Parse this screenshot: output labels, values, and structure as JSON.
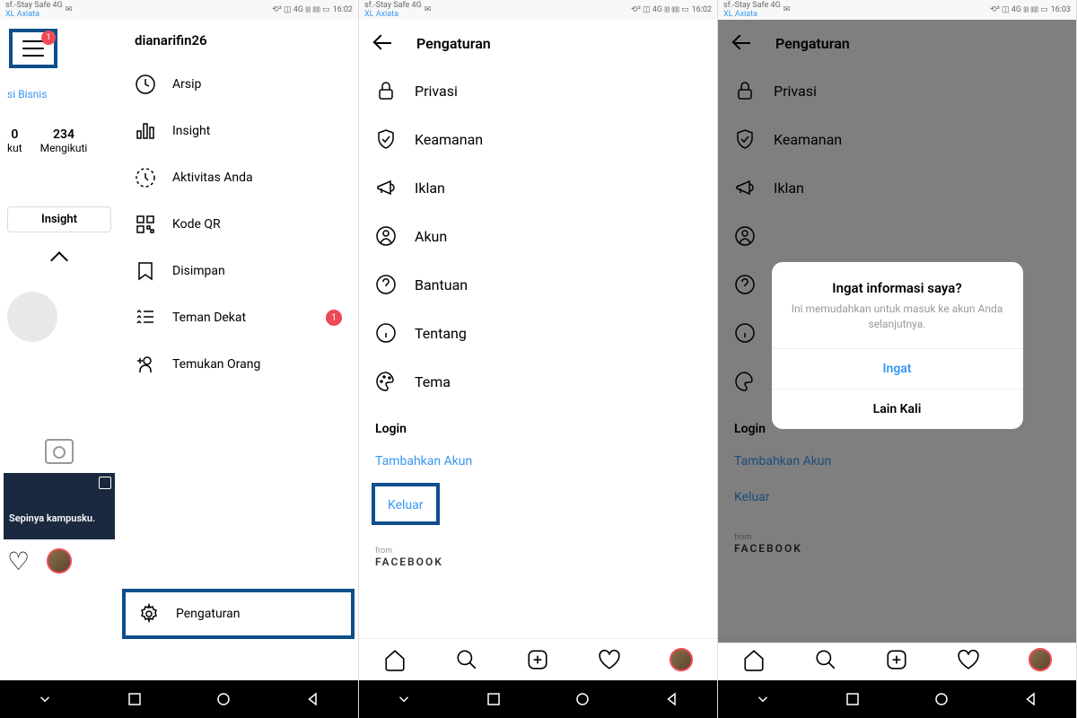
{
  "status": {
    "carrier_top": "sf.-Stay Safe 4G",
    "carrier_bottom": "XL Axiata",
    "time_1": "16:02",
    "time_2": "16:02",
    "time_3": "16:03",
    "net": "4G"
  },
  "phone1": {
    "notification_count": "1",
    "biz_link": "si Bisnis",
    "stat1_num": "0",
    "stat1_label": "kut",
    "stat2_num": "234",
    "stat2_label": "Mengikuti",
    "insight_btn": "Insight",
    "story_text": "Sepinya kampusku.",
    "username": "dianarifin26",
    "menu": {
      "arsip": "Arsip",
      "insight": "Insight",
      "aktivitas": "Aktivitas Anda",
      "kode_qr": "Kode QR",
      "disimpan": "Disimpan",
      "teman": "Teman Dekat",
      "teman_badge": "1",
      "temukan": "Temukan Orang"
    },
    "settings": "Pengaturan"
  },
  "phone2": {
    "title": "Pengaturan",
    "items": {
      "privasi": "Privasi",
      "keamanan": "Keamanan",
      "iklan": "Iklan",
      "akun": "Akun",
      "bantuan": "Bantuan",
      "tentang": "Tentang",
      "tema": "Tema"
    },
    "login_section": "Login",
    "tambah_akun": "Tambahkan Akun",
    "keluar": "Keluar",
    "from": "from",
    "facebook": "FACEBOOK"
  },
  "phone3": {
    "title": "Pengaturan",
    "items": {
      "privasi": "Privasi",
      "keamanan": "Keamanan",
      "iklan": "Iklan"
    },
    "login_section": "Login",
    "tambah_akun": "Tambahkan Akun",
    "keluar": "Keluar",
    "from": "from",
    "facebook": "FACEBOOK",
    "dialog": {
      "title": "Ingat informasi saya?",
      "text": "Ini memudahkan untuk masuk ke akun Anda selanjutnya.",
      "primary": "Ingat",
      "secondary": "Lain Kali"
    }
  }
}
